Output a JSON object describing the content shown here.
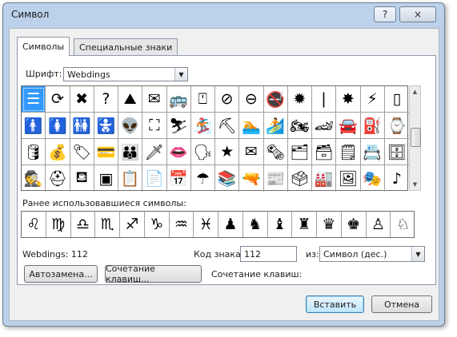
{
  "window": {
    "title": "Символ",
    "help_label": "?",
    "close_label": "×"
  },
  "tabs": [
    {
      "label": "Символы"
    },
    {
      "label": "Специальные знаки"
    }
  ],
  "font": {
    "label": "Шрифт:",
    "value": "Webdings"
  },
  "symbols": [
    "☰",
    "⟳",
    "✖",
    "?",
    "⛰",
    "✉",
    "🚌",
    "⍞",
    "⊘",
    "⊖",
    "🚭",
    "✹",
    "❘",
    "✸",
    "⚡",
    "▯",
    "🚹",
    "🚺",
    "🚻",
    "🚼",
    "👽",
    "⛶",
    "⛷",
    "🏂",
    "⛏",
    "🏊",
    "🏄",
    "🏍",
    "🏎",
    "🚘",
    "⛽",
    "⌚",
    "🛢",
    "💰",
    "🏷",
    "💳",
    "👪",
    "🗡",
    "👄",
    "🗣",
    "★",
    "✉",
    "🗞",
    "🗂",
    "🗃",
    "🗒",
    "📇",
    "🗄",
    "🕵",
    "⛑",
    "⛾",
    "▣",
    "📋",
    "📄",
    "📅",
    "☂",
    "📚",
    "🔫",
    "📰",
    "🗳",
    "🏭",
    "🖼",
    "🎭",
    "♪"
  ],
  "selected_index": 0,
  "recent": {
    "label": "Ранее использовавшиеся символы:",
    "symbols": [
      "♌",
      "♍",
      "♎",
      "♏",
      "♐",
      "♑",
      "♒",
      "♓",
      "♟",
      "♞",
      "♝",
      "♜",
      "♛",
      "♚",
      "♙",
      "♘"
    ]
  },
  "info": {
    "font_code": "Webdings: 112"
  },
  "code": {
    "label": "Код знака:",
    "value": "112",
    "from_label": "из:",
    "from_value": "Символ (дес.)"
  },
  "buttons": {
    "autocorrect": "Автозамена...",
    "shortcut": "Сочетание клавиш...",
    "shortcut_label": "Сочетание клавиш:",
    "insert": "Вставить",
    "cancel": "Отмена"
  },
  "colors": {
    "frame": "#bcd1ea",
    "selection": "#3399ff"
  }
}
